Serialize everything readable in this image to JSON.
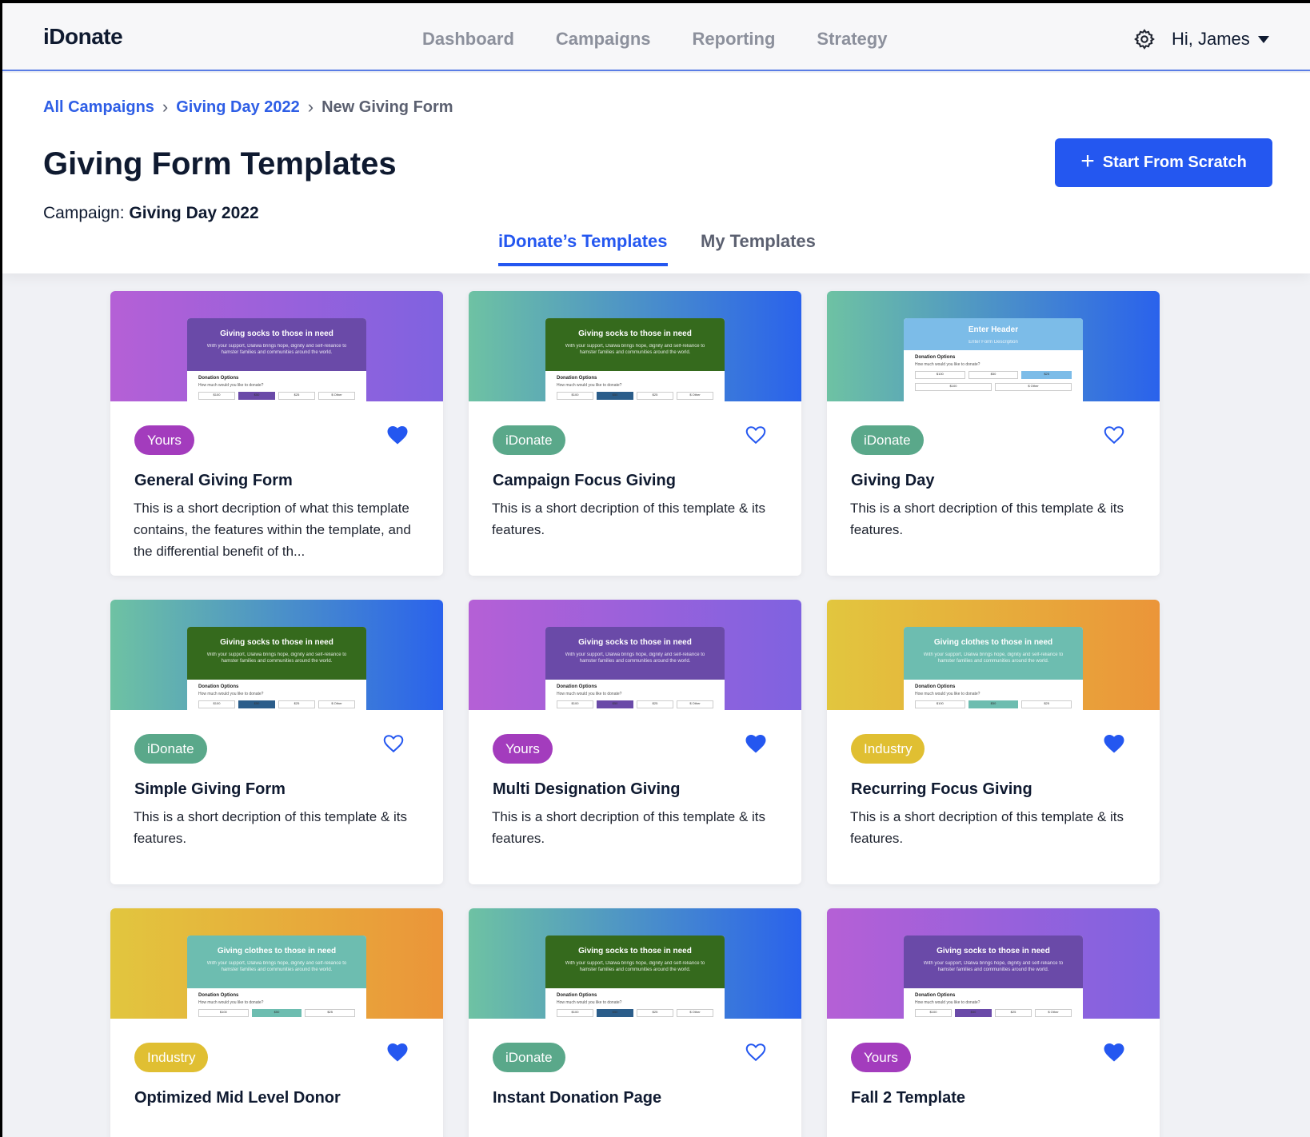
{
  "nav": {
    "logo": "iDonate",
    "links": [
      "Dashboard",
      "Campaigns",
      "Reporting",
      "Strategy"
    ],
    "user_greeting": "Hi, James"
  },
  "breadcrumb": [
    "All Campaigns",
    "Giving Day 2022",
    "New Giving Form"
  ],
  "page": {
    "title": "Giving Form Templates",
    "campaign_label": "Campaign:",
    "campaign_name": "Giving Day 2022",
    "start_button": "Start From Scratch"
  },
  "tabs": [
    "iDonate’s Templates",
    "My Templates"
  ],
  "preview_text": {
    "socks": "Giving socks to those in need",
    "clothes": "Giving clothes to those in need",
    "enter_header": "Enter Header",
    "enter_subheader": "Enter Form Description",
    "sub": "With your support, Dlalwa brings hope, dignity and self-reliance to hamster families and communities around the world.",
    "options_label": "Donation Options",
    "question": "How much would you like to donate?",
    "amounts": [
      "$100",
      "$50",
      "$25",
      "$ Other"
    ]
  },
  "cards": [
    {
      "badge": "Yours",
      "title": "General Giving Form",
      "desc": "This is a short decription of what this template contains, the features within the template, and the differential benefit of th...",
      "favorite": true
    },
    {
      "badge": "iDonate",
      "title": "Campaign Focus Giving",
      "desc": "This is a short decription of this template & its features.",
      "favorite": false
    },
    {
      "badge": "iDonate",
      "title": "Giving Day",
      "desc": "This is a short decription of this template & its features.",
      "favorite": false
    },
    {
      "badge": "iDonate",
      "title": "Simple Giving Form",
      "desc": "This is a short decription of this template & its features.",
      "favorite": false
    },
    {
      "badge": "Yours",
      "title": "Multi Designation Giving",
      "desc": "This is a short decription of this template & its features.",
      "favorite": true
    },
    {
      "badge": "Industry",
      "title": "Recurring Focus Giving",
      "desc": "This is a short decription of this template & its features.",
      "favorite": true
    },
    {
      "badge": "Industry",
      "title": "Optimized Mid Level Donor",
      "desc": "",
      "favorite": true
    },
    {
      "badge": "iDonate",
      "title": "Instant Donation Page",
      "desc": "",
      "favorite": false
    },
    {
      "badge": "Yours",
      "title": "Fall 2 Template",
      "desc": "",
      "favorite": true
    }
  ],
  "colors": {
    "accent": "#2457f0",
    "heart": "#2457f0",
    "badge_yours": "#a33cbd",
    "badge_idonate": "#5aa88a",
    "badge_industry": "#e0bf32"
  }
}
